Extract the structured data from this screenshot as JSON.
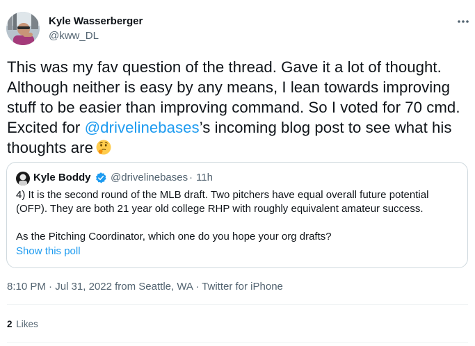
{
  "author": {
    "name": "Kyle Wasserberger",
    "handle": "@kww_DL"
  },
  "tweet": {
    "text_before": "This was my fav question of the thread. Gave it a lot of thought. Although neither is easy by any means, I lean towards improving stuff to be easier than improving command. So I voted for 70 cmd. Excited for ",
    "mention": "@drivelinebases",
    "text_after": "’s incoming blog post to see what his thoughts are",
    "emoji": "thinking-face-icon"
  },
  "quoted": {
    "name": "Kyle Boddy",
    "handle": "@drivelinebases",
    "separator": "·",
    "time": "11h",
    "paragraph1": "4) It is the second round of the MLB draft. Two pitchers have equal overall future potential (OFP). They are both 21 year old college RHP with roughly equivalent amateur success.",
    "paragraph2": "As the Pitching Coordinator, which one do you hope your org drafts?",
    "poll_link": "Show this poll"
  },
  "meta": {
    "time": "8:10 PM",
    "sep1": " · ",
    "date": "Jul 31, 2022",
    "location": " from Seattle, WA",
    "sep2": " · ",
    "source": "Twitter for iPhone"
  },
  "stats": {
    "likes_count": "2",
    "likes_label": "Likes"
  },
  "colors": {
    "accent": "#1d9bf0",
    "secondary_text": "#536471",
    "border": "#cfd9de"
  }
}
